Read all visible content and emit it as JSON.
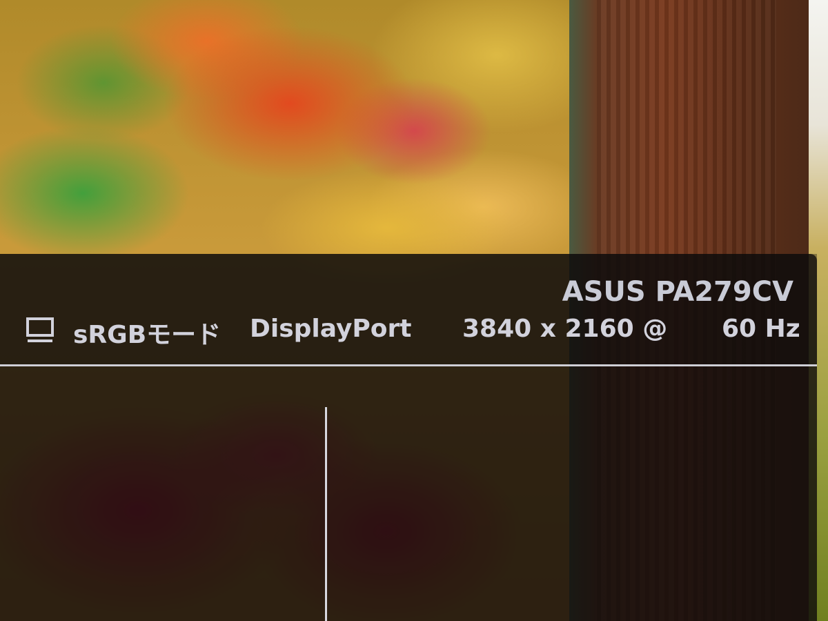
{
  "osd": {
    "model_name": "ASUS PA279CV",
    "status": {
      "monitor_icon": "monitor-icon",
      "mode": "sRGBモード",
      "input": "DisplayPort",
      "resolution": "3840 x 2160 @",
      "refresh_rate": "60 Hz"
    }
  },
  "colors": {
    "osd_background": "#120e0e",
    "osd_text": "#d2d2dc",
    "divider": "#cfcfd6"
  }
}
